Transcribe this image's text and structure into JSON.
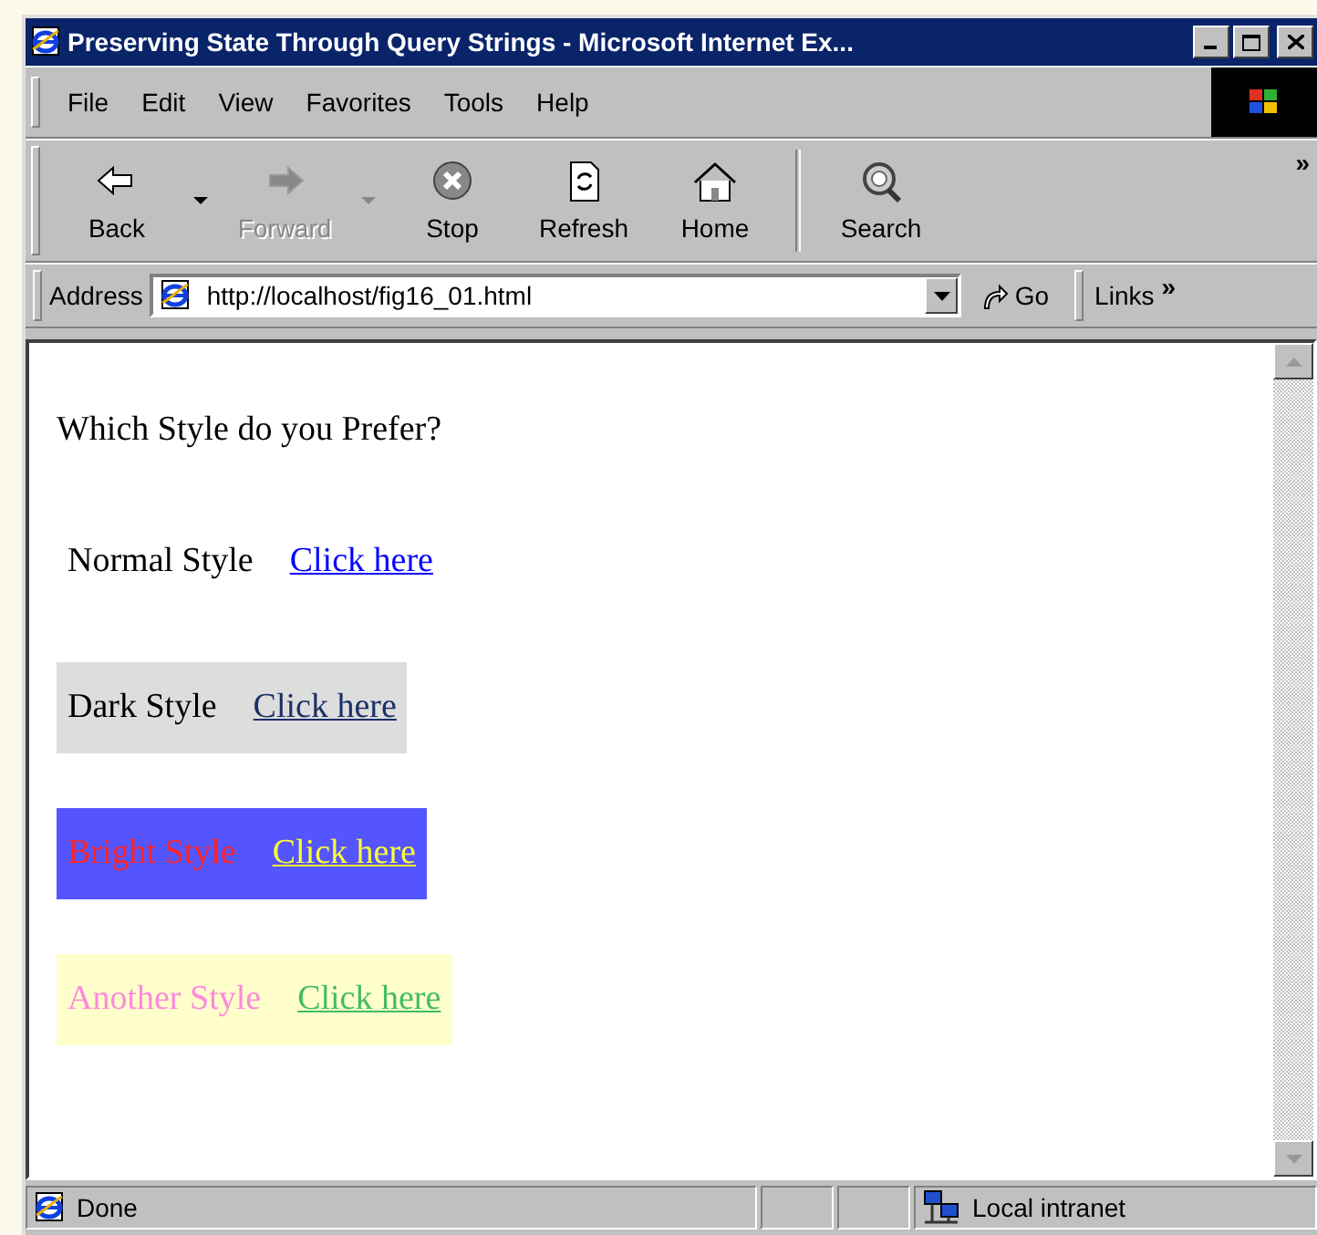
{
  "window": {
    "title": "Preserving State Through Query Strings - Microsoft Internet Ex..."
  },
  "menu": [
    "File",
    "Edit",
    "View",
    "Favorites",
    "Tools",
    "Help"
  ],
  "toolbar": [
    {
      "kind": "back",
      "label": "Back",
      "disabled": false,
      "dropdown": true
    },
    {
      "kind": "forward",
      "label": "Forward",
      "disabled": true,
      "dropdown": true
    },
    {
      "kind": "stop",
      "label": "Stop",
      "disabled": false,
      "dropdown": false
    },
    {
      "kind": "refresh",
      "label": "Refresh",
      "disabled": false,
      "dropdown": false
    },
    {
      "kind": "home",
      "label": "Home",
      "disabled": false,
      "dropdown": false
    },
    {
      "kind": "search",
      "label": "Search",
      "disabled": false,
      "dropdown": false
    }
  ],
  "toolbar_more": "»",
  "address_bar": {
    "label": "Address",
    "value": "http://localhost/fig16_01.html",
    "go": "Go",
    "links": "Links",
    "more": "»"
  },
  "page": {
    "heading": "Which Style do you Prefer?",
    "styles": [
      {
        "kind": "normal",
        "label": "Normal Style",
        "link": "Click here"
      },
      {
        "kind": "dark",
        "label": "Dark Style",
        "link": "Click here"
      },
      {
        "kind": "bright",
        "label": "Bright Style",
        "link": "Click here"
      },
      {
        "kind": "another",
        "label": "Another Style",
        "link": "Click here"
      }
    ]
  },
  "status_bar": {
    "status": "Done",
    "zone": "Local intranet"
  }
}
